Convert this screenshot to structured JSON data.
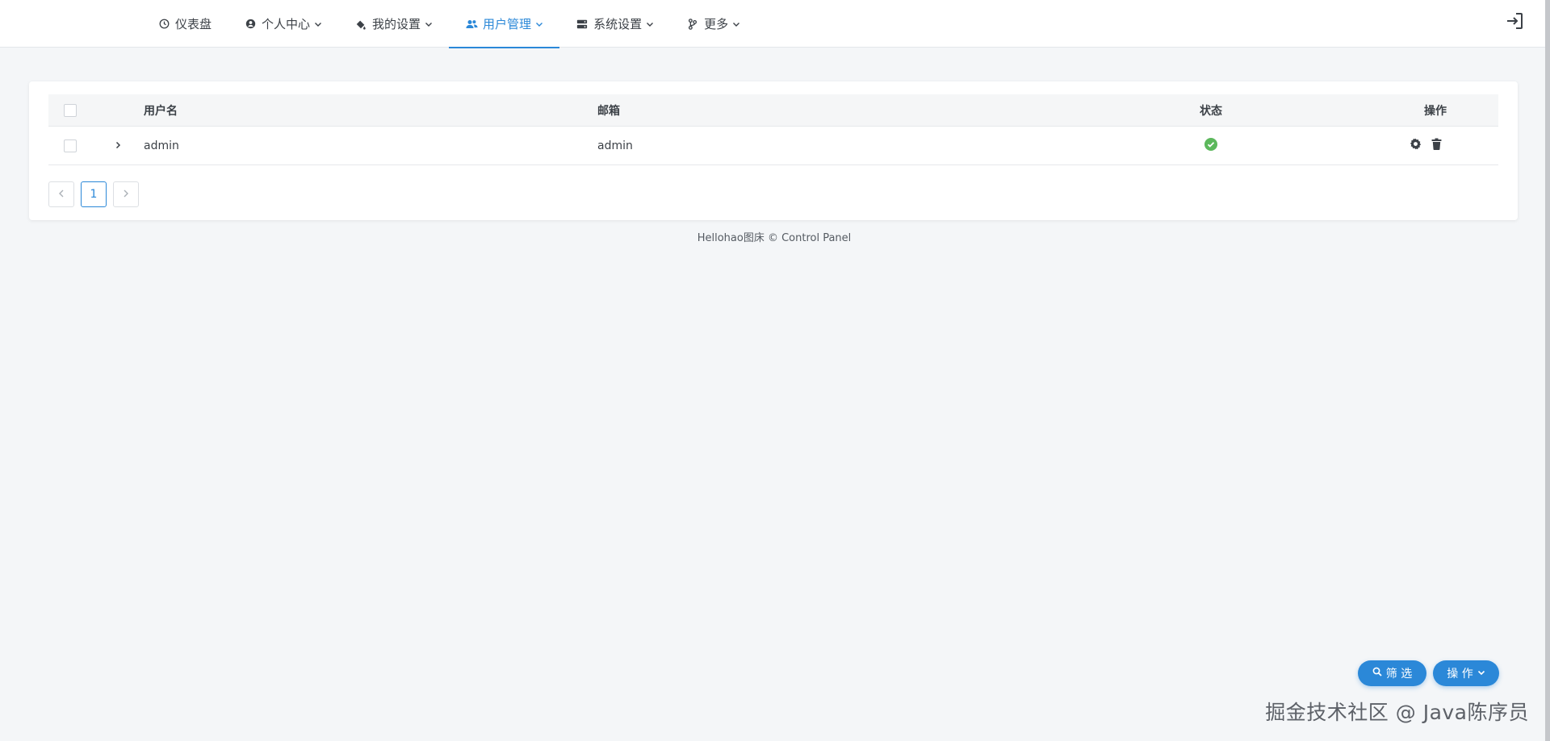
{
  "nav": {
    "items": [
      {
        "label": "仪表盘",
        "icon": "clock-icon",
        "has_dropdown": false
      },
      {
        "label": "个人中心",
        "icon": "user-circle-icon",
        "has_dropdown": true
      },
      {
        "label": "我的设置",
        "icon": "paint-bucket-icon",
        "has_dropdown": true
      },
      {
        "label": "用户管理",
        "icon": "users-icon",
        "has_dropdown": true,
        "active": true
      },
      {
        "label": "系统设置",
        "icon": "server-icon",
        "has_dropdown": true
      },
      {
        "label": "更多",
        "icon": "code-branch-icon",
        "has_dropdown": true
      }
    ],
    "logout_icon": "logout-icon",
    "accent_color": "#2b88d8"
  },
  "table": {
    "columns": {
      "username": "用户名",
      "email": "邮箱",
      "status": "状态",
      "actions": "操作"
    },
    "rows": [
      {
        "username": "admin",
        "email": "admin",
        "status": "active",
        "status_icon": "check-circle-icon",
        "status_color": "#5cb85c"
      }
    ]
  },
  "pagination": {
    "current": "1"
  },
  "footer": {
    "text": "Hellohao图床 © Control Panel"
  },
  "buttons": {
    "filter_label": "筛 选",
    "ops_label": "操 作"
  },
  "watermark": "掘金技术社区 @ Java陈序员"
}
